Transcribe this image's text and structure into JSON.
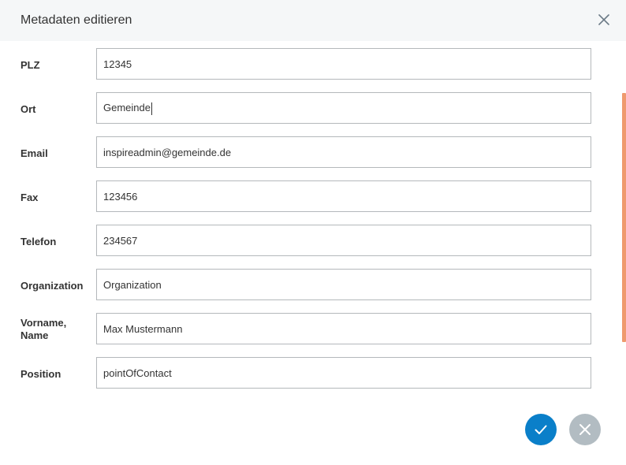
{
  "dialog": {
    "title": "Metadaten editieren",
    "close_icon": "close-icon"
  },
  "fields": [
    {
      "label": "PLZ",
      "value": "12345"
    },
    {
      "label": "Ort",
      "value": "Gemeinde"
    },
    {
      "label": "Email",
      "value": "inspireadmin@gemeinde.de"
    },
    {
      "label": "Fax",
      "value": "123456"
    },
    {
      "label": "Telefon",
      "value": "234567"
    },
    {
      "label": "Organization",
      "value": "Organization"
    },
    {
      "label": "Vorname, Name",
      "value": "Max Mustermann"
    },
    {
      "label": "Position",
      "value": "pointOfContact"
    }
  ],
  "actions": {
    "confirm_icon": "checkmark-icon",
    "cancel_icon": "close-icon"
  },
  "colors": {
    "confirm": "#0a7fc9",
    "cancel": "#b2bcc2",
    "scrollbar": "#ef9a6e",
    "header_bg": "#f5f7f8"
  }
}
